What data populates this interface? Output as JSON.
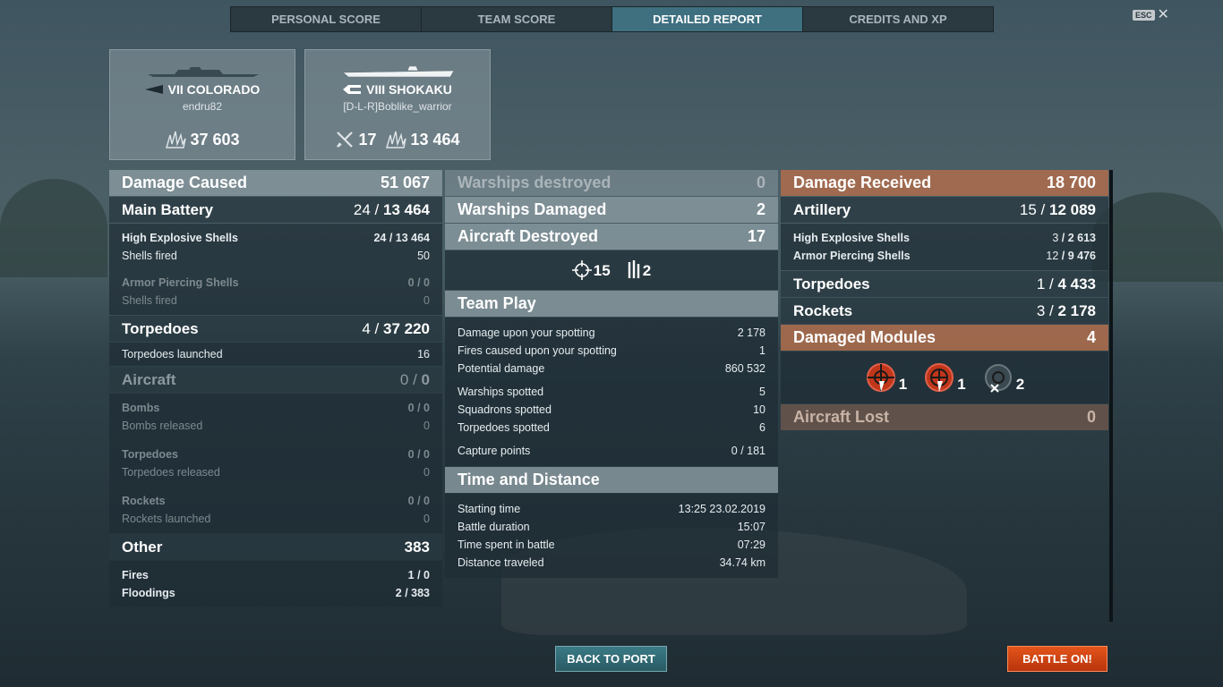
{
  "tabs": [
    "PERSONAL SCORE",
    "TEAM SCORE",
    "DETAILED REPORT",
    "CREDITS AND XP"
  ],
  "esc": {
    "key": "ESC",
    "close": "✕"
  },
  "ships": [
    {
      "name": "VII COLORADO",
      "player": "endru82",
      "stats": [
        {
          "icon": "damage-splash-icon",
          "value": "37 603"
        }
      ]
    },
    {
      "name": "VIII SHOKAKU",
      "player": "[D-L-R]Boblike_warrior",
      "stats": [
        {
          "icon": "plane-shot-down-icon",
          "value": "17"
        },
        {
          "icon": "damage-splash-icon",
          "value": "13 464"
        }
      ]
    }
  ],
  "left": {
    "damage_caused": {
      "label": "Damage Caused",
      "value": "51 067"
    },
    "main_battery": {
      "label": "Main Battery",
      "hits": "24",
      "total": "13 464"
    },
    "he": {
      "label": "High Explosive Shells",
      "hits": "24",
      "total": "13 464",
      "fired_label": "Shells fired",
      "fired": "50"
    },
    "ap": {
      "label": "Armor Piercing Shells",
      "hits": "0",
      "total": "0",
      "fired_label": "Shells fired",
      "fired": "0"
    },
    "torpedoes": {
      "label": "Torpedoes",
      "hits": "4",
      "total": "37 220",
      "launched_label": "Torpedoes launched",
      "launched": "16"
    },
    "aircraft": {
      "label": "Aircraft",
      "hits": "0",
      "total": "0"
    },
    "bombs": {
      "label": "Bombs",
      "hits": "0",
      "total": "0",
      "sub_label": "Bombs released",
      "sub": "0"
    },
    "air_torps": {
      "label": "Torpedoes",
      "hits": "0",
      "total": "0",
      "sub_label": "Torpedoes released",
      "sub": "0"
    },
    "rockets": {
      "label": "Rockets",
      "hits": "0",
      "total": "0",
      "sub_label": "Rockets launched",
      "sub": "0"
    },
    "other": {
      "label": "Other",
      "value": "383"
    },
    "fires": {
      "label": "Fires",
      "hits": "1",
      "total": "0"
    },
    "floodings": {
      "label": "Floodings",
      "hits": "2",
      "total": "383"
    }
  },
  "mid": {
    "destroyed": {
      "label": "Warships destroyed",
      "value": "0"
    },
    "damaged": {
      "label": "Warships Damaged",
      "value": "2"
    },
    "aircraft": {
      "label": "Aircraft Destroyed",
      "value": "17"
    },
    "aircraft_icons": [
      {
        "icon": "crosshair-icon",
        "value": "15"
      },
      {
        "icon": "fighters-icon",
        "value": "2"
      }
    ],
    "team_play": {
      "label": "Team Play",
      "rows": [
        {
          "label": "Damage upon your spotting",
          "value": "2 178"
        },
        {
          "label": "Fires caused upon your spotting",
          "value": "1"
        },
        {
          "label": "Potential damage",
          "value": "860 532"
        },
        {
          "label": "Warships spotted",
          "value": "5"
        },
        {
          "label": "Squadrons spotted",
          "value": "10"
        },
        {
          "label": "Torpedoes spotted",
          "value": "6"
        },
        {
          "label": "Capture points",
          "value": "0 / 181"
        }
      ]
    },
    "time": {
      "label": "Time and Distance",
      "rows": [
        {
          "label": "Starting time",
          "value": "13:25  23.02.2019"
        },
        {
          "label": "Battle duration",
          "value": "15:07"
        },
        {
          "label": "Time spent in battle",
          "value": "07:29"
        },
        {
          "label": "Distance traveled",
          "value": "34.74 km"
        }
      ]
    }
  },
  "right": {
    "received": {
      "label": "Damage Received",
      "value": "18 700"
    },
    "artillery": {
      "label": "Artillery",
      "hits": "15",
      "total": "12 089"
    },
    "he": {
      "label": "High Explosive Shells",
      "hits": "3",
      "total": "2 613"
    },
    "ap": {
      "label": "Armor Piercing Shells",
      "hits": "12",
      "total": "9 476"
    },
    "torpedoes": {
      "label": "Torpedoes",
      "hits": "1",
      "total": "4 433"
    },
    "rockets": {
      "label": "Rockets",
      "hits": "3",
      "total": "2 178"
    },
    "modules": {
      "label": "Damaged Modules",
      "value": "4"
    },
    "module_icons": [
      {
        "icon": "steering-gear-damaged-icon",
        "value": "1"
      },
      {
        "icon": "engine-damaged-icon",
        "value": "1"
      },
      {
        "icon": "module-destroyed-icon",
        "value": "2"
      }
    ],
    "aircraft_lost": {
      "label": "Aircraft Lost",
      "value": "0"
    }
  },
  "buttons": {
    "back": "BACK TO PORT",
    "battle": "BATTLE ON!"
  }
}
